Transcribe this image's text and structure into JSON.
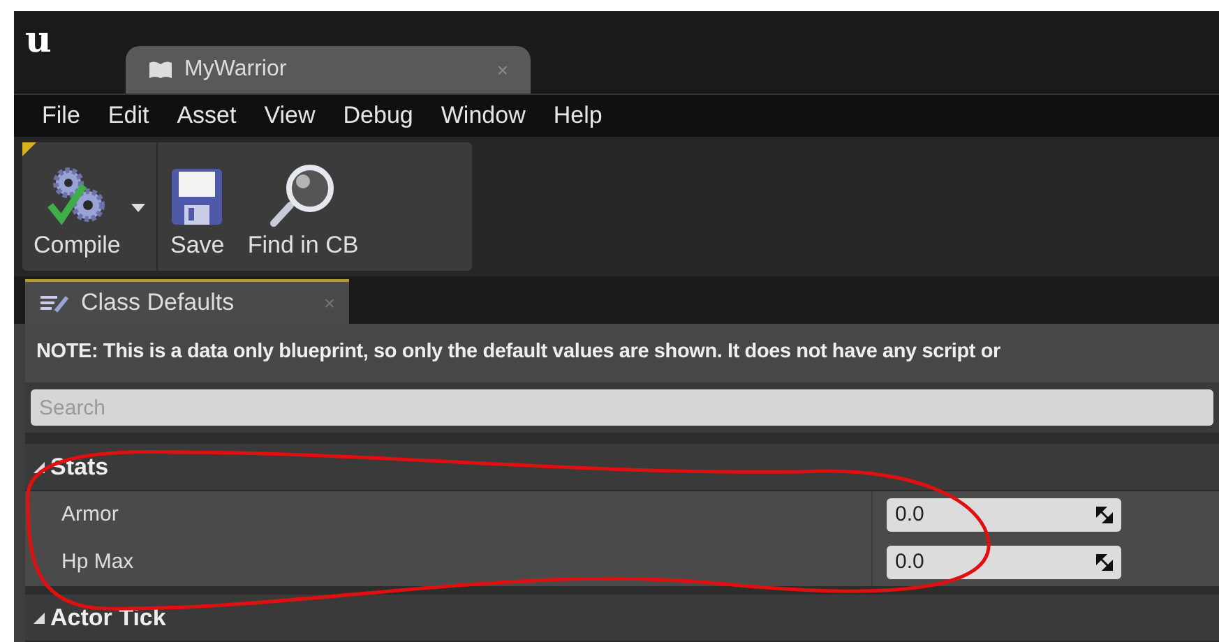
{
  "window": {
    "logo": "u",
    "tabs": [
      {
        "label": "MyWarrior",
        "close": "×",
        "selected": true
      }
    ]
  },
  "menu": [
    "File",
    "Edit",
    "Asset",
    "View",
    "Debug",
    "Window",
    "Help"
  ],
  "toolbar": [
    {
      "label": "Compile",
      "kind": "compile",
      "dropdown": true
    },
    {
      "label": "Save",
      "kind": "save",
      "dropdown": false
    },
    {
      "label": "Find in CB",
      "kind": "find",
      "dropdown": false
    }
  ],
  "panel_tabs": [
    {
      "label": "Class Defaults",
      "close": "×",
      "selected": true
    }
  ],
  "note": "NOTE: This is a data only blueprint, so only the default values are shown.  It does not have any script or",
  "search": {
    "placeholder": "Search"
  },
  "categories": [
    {
      "name": "Stats",
      "expanded": true,
      "properties": [
        {
          "name": "Armor",
          "value": "0.0"
        },
        {
          "name": "Hp Max",
          "value": "0.0"
        }
      ]
    },
    {
      "name": "Actor Tick",
      "expanded": true
    }
  ]
}
